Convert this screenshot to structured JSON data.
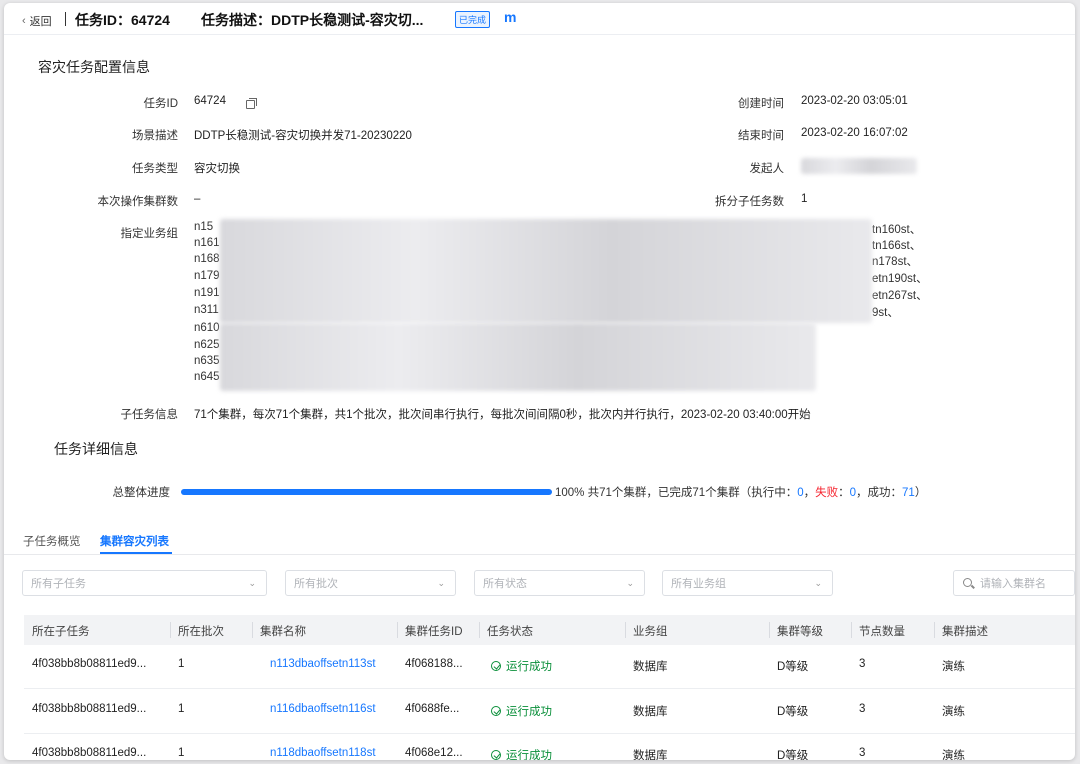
{
  "header": {
    "back_label": "返回",
    "task_id_title": "任务ID：64724",
    "task_desc_title": "任务描述：DDTP长稳测试-容灾切...",
    "status_tag": "已完成",
    "brand_glyph": "m"
  },
  "config": {
    "title": "容灾任务配置信息",
    "task_id_label": "任务ID",
    "task_id_value": "64724",
    "scene_label": "场景描述",
    "scene_value": "DDTP长稳测试-容灾切换并发71-20230220",
    "type_label": "任务类型",
    "type_value": "容灾切换",
    "cluster_count_label": "本次操作集群数",
    "cluster_count_value": "–",
    "biz_group_label": "指定业务组",
    "biz_group_lines": [
      {
        "prefix": "n15",
        "suffix": "tn160st、"
      },
      {
        "prefix": "n161",
        "suffix": "tn166st、"
      },
      {
        "prefix": "n168",
        "suffix": "n178st、"
      },
      {
        "prefix": "n179",
        "suffix": "etn190st、"
      },
      {
        "prefix": "n191",
        "suffix": "etn267st、"
      },
      {
        "prefix": "n311",
        "suffix": "9st、"
      },
      {
        "prefix": "n610",
        "suffix": ""
      },
      {
        "prefix": "n625",
        "suffix": ""
      },
      {
        "prefix": "n635",
        "suffix": ""
      },
      {
        "prefix": "n645",
        "suffix": ""
      }
    ],
    "subtask_info_label": "子任务信息",
    "subtask_info_value": "71个集群，每次71个集群，共1个批次，批次间串行执行，每批次间间隔0秒，批次内并行执行，2023-02-20 03:40:00开始",
    "create_time_label": "创建时间",
    "create_time_value": "2023-02-20 03:05:01",
    "end_time_label": "结束时间",
    "end_time_value": "2023-02-20 16:07:02",
    "initiator_label": "发起人",
    "split_label": "拆分子任务数",
    "split_value": "1"
  },
  "detail": {
    "title": "任务详细信息",
    "progress_label": "总整体进度",
    "progress_percent": 100,
    "progress_text": "100% 共71个集群，已完成71个集群（执行中：",
    "running_count": "0",
    "fail_label": "失败",
    "fail_count": "0",
    "success_label": "成功",
    "success_count": "71",
    "sep_colon": "：",
    "sep_comma": "，",
    "close_paren": "）"
  },
  "tabs": [
    {
      "label": "子任务概览"
    },
    {
      "label": "集群容灾列表"
    }
  ],
  "filters": {
    "subtask_placeholder": "所有子任务",
    "batch_placeholder": "所有批次",
    "status_placeholder": "所有状态",
    "biz_placeholder": "所有业务组",
    "search_placeholder": "请输入集群名"
  },
  "table": {
    "columns": [
      "所在子任务",
      "所在批次",
      "集群名称",
      "集群任务ID",
      "任务状态",
      "业务组",
      "集群等级",
      "节点数量",
      "集群描述"
    ],
    "rows": [
      {
        "subtask": "4f038bb8b08811ed9...",
        "batch": "1",
        "cluster": "n113dbaoffsetn113st",
        "cluster_task_id": "4f068188...",
        "status": "运行成功",
        "biz_group": "数据库",
        "level": "D等级",
        "nodes": "3",
        "desc": "演练"
      },
      {
        "subtask": "4f038bb8b08811ed9...",
        "batch": "1",
        "cluster": "n116dbaoffsetn116st",
        "cluster_task_id": "4f0688fe...",
        "status": "运行成功",
        "biz_group": "数据库",
        "level": "D等级",
        "nodes": "3",
        "desc": "演练"
      },
      {
        "subtask": "4f038bb8b08811ed9...",
        "batch": "1",
        "cluster": "n118dbaoffsetn118st",
        "cluster_task_id": "4f068e12...",
        "status": "运行成功",
        "biz_group": "数据库",
        "level": "D等级",
        "nodes": "3",
        "desc": "演练"
      }
    ]
  },
  "colors": {
    "accent": "#1677ff",
    "success": "#0a8f3a",
    "fail": "#f5222d"
  }
}
